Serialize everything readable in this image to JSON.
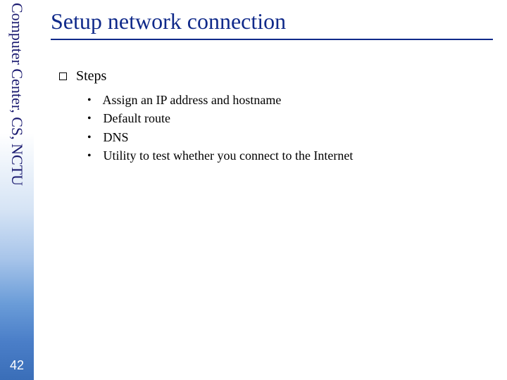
{
  "sidebar": {
    "org_label": "Computer Center, CS, NCTU",
    "page_number": "42"
  },
  "slide": {
    "title": "Setup network connection",
    "steps_label": "Steps",
    "steps_items": [
      "Assign an IP address and hostname",
      "Default route",
      "DNS",
      "Utility to test whether you connect to the Internet"
    ]
  }
}
